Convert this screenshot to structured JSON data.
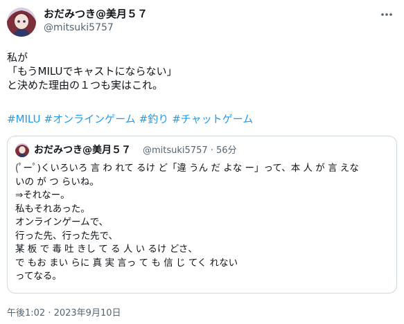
{
  "author": {
    "name": "おだみつき@美月５７",
    "handle": "@mitsuki5757"
  },
  "tweet": {
    "lines": [
      "私が",
      "「もうMILUでキャストにならない」",
      "と決めた理由の１つも実はこれ。"
    ],
    "hashtags": [
      "#MILU",
      "#オンラインゲーム",
      "#釣り",
      "#チャットゲーム"
    ]
  },
  "quote": {
    "name": "おだみつき@美月５７",
    "meta": "@mitsuki5757 · 56分",
    "lines": [
      "(ﾟーﾟ)くいろいろ 言 わ れて るけ ど「違 うん だ よな ー」って、本 人 が 言 えな",
      "いの が つ らいね。",
      "⇒それなー。",
      "私もそれあった。",
      "オンラインゲームで、",
      "行った先、行った先で、",
      "某 板 で 毒 吐 きし て る 人 い るけ どさ、",
      "で もお まい らに 真 実 言っ て も 信 じ てく れない",
      "ってなる。"
    ]
  },
  "timestamp": "午後1:02 · 2023年9月10日",
  "icons": {
    "more": "more-horizontal-icon",
    "avatar": "avatar"
  },
  "colors": {
    "link": "#1d9bf0",
    "secondary_text": "#536471",
    "border": "#cfd9de"
  }
}
